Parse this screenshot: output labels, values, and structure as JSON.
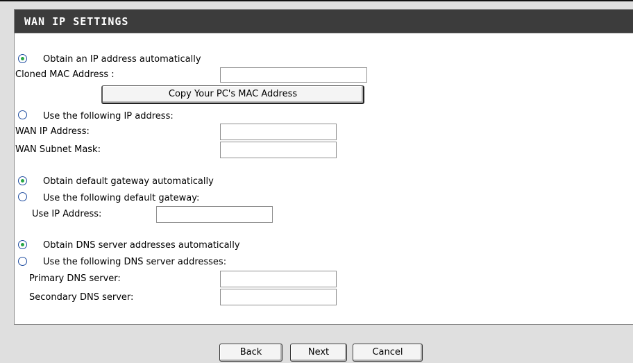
{
  "panel": {
    "title": "WAN IP SETTINGS"
  },
  "ip": {
    "auto_label": "Obtain an IP address automatically",
    "auto_selected": true,
    "cloned_mac_label": "Cloned MAC Address :",
    "cloned_mac_value": "",
    "copy_mac_button": "Copy Your PC's MAC Address",
    "manual_label": "Use the following IP address:",
    "manual_selected": false,
    "wan_ip_label": "WAN IP Address:",
    "wan_ip_value": "",
    "subnet_label": "WAN Subnet Mask:",
    "subnet_value": ""
  },
  "gateway": {
    "auto_label": "Obtain default gateway automatically",
    "auto_selected": true,
    "manual_label": "Use the following default gateway:",
    "manual_selected": false,
    "use_ip_label": "Use IP Address:",
    "use_ip_value": ""
  },
  "dns": {
    "auto_label": "Obtain DNS server addresses automatically",
    "auto_selected": true,
    "manual_label": "Use the following DNS server addresses:",
    "manual_selected": false,
    "primary_label": "Primary DNS server:",
    "primary_value": "",
    "secondary_label": "Secondary DNS server:",
    "secondary_value": ""
  },
  "buttons": {
    "back": "Back",
    "next": "Next",
    "cancel": "Cancel"
  },
  "colors": {
    "header_bg": "#3c3c3c",
    "radio_border": "#1f4da0",
    "radio_dot": "#28a745"
  }
}
